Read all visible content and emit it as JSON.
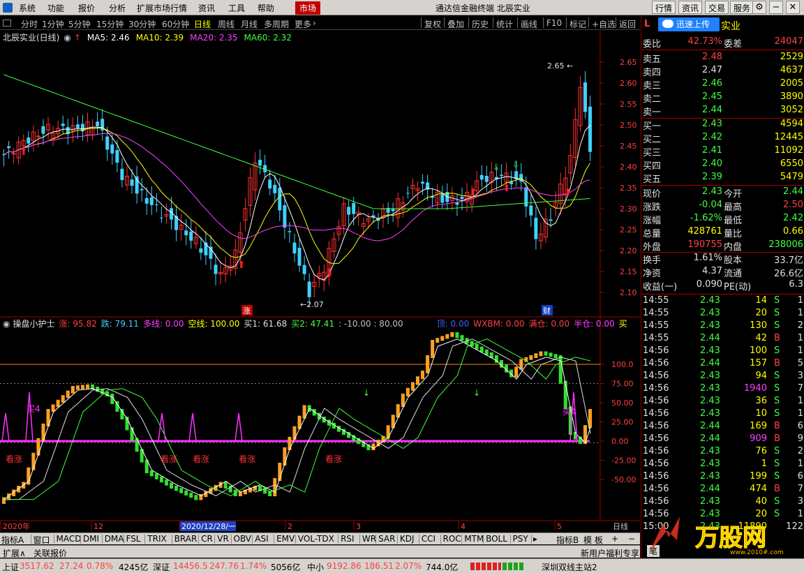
{
  "menubar": {
    "items": [
      "系统",
      "功能",
      "报价",
      "分析",
      "扩展市场行情",
      "资讯",
      "工具",
      "帮助"
    ],
    "active_tab": "市场",
    "window_title": "通达信金融终端 北辰实业",
    "right_buttons": [
      "行情",
      "资讯",
      "交易",
      "服务"
    ],
    "win_icons": [
      "settings-icon",
      "minimize-icon",
      "restore-icon",
      "close-icon"
    ]
  },
  "periodbar": {
    "periods": [
      "分时",
      "1分钟",
      "5分钟",
      "15分钟",
      "30分钟",
      "60分钟",
      "日线",
      "周线",
      "月线",
      "多周期",
      "更多"
    ],
    "selected": "日线",
    "tools": [
      "复权",
      "叠加",
      "历史",
      "统计",
      "画线",
      "F10",
      "标记",
      "+自选",
      "返回"
    ]
  },
  "main": {
    "title": "北辰实业(日线)",
    "ma": [
      {
        "label": "MA5: 2.46",
        "color": "#ffffff"
      },
      {
        "label": "MA10: 2.39",
        "color": "#ffff00"
      },
      {
        "label": "MA20: 2.35",
        "color": "#ff40ff"
      },
      {
        "label": "MA60: 2.32",
        "color": "#40ff40"
      }
    ],
    "high_label": "2.65",
    "low_label": "←2.07",
    "y_ticks": [
      "2.65",
      "2.60",
      "2.55",
      "2.50",
      "2.45",
      "2.40",
      "2.35",
      "2.30",
      "2.25",
      "2.20",
      "2.15",
      "2.10"
    ],
    "markers": [
      "涨",
      "财"
    ]
  },
  "indicator": {
    "name": "操盘小护士",
    "fields": [
      {
        "label": "涨: 95.82",
        "color": "#ff4040"
      },
      {
        "label": "跌: 79.11",
        "color": "#40d0ff"
      },
      {
        "label": "多线: 0.00",
        "color": "#ff40ff"
      },
      {
        "label": "空线: 100.00",
        "color": "#ffff00"
      },
      {
        "label": "买1: 61.68",
        "color": "#e0e0e0"
      },
      {
        "label": "买2: 47.41",
        "color": "#40ff40"
      },
      {
        "label": ": -10.00 : 80.00",
        "color": "#c0c0c0"
      },
      {
        "label": "顶: 0.00",
        "color": "#4060ff"
      },
      {
        "label": "WXBM: 0.00",
        "color": "#ff4040"
      },
      {
        "label": "满仓: 0.00",
        "color": "#ff4040"
      },
      {
        "label": "半仓: 0.00",
        "color": "#ff40ff"
      },
      {
        "label": "买",
        "color": "#ffff00"
      }
    ],
    "y_ticks": [
      "100.0",
      "75.00",
      "50.00",
      "25.00",
      "0.00",
      "-25.00",
      "-50.00"
    ],
    "labels": [
      "买4",
      "看涨",
      "看涨",
      "看涨",
      "看涨",
      "看涨",
      "买4"
    ]
  },
  "x_axis": {
    "labels": [
      "2020年",
      "12",
      "2020/12/28/一",
      "2",
      "3",
      "4",
      "5"
    ],
    "right_label": "日线"
  },
  "tabs": {
    "items": [
      "指标A",
      "窗口",
      "MACD",
      "DMI",
      "DMA",
      "FSL",
      "TRIX",
      "BRAR",
      "CR",
      "VR",
      "OBV",
      "ASI",
      "EMV",
      "VOL-TDX",
      "RSI",
      "WR",
      "SAR",
      "KDJ",
      "CCI",
      "ROC",
      "MTM",
      "BOLL",
      "PSY"
    ],
    "right": [
      "指标B",
      "模 板",
      "+",
      "−"
    ]
  },
  "status": {
    "left": [
      "扩展∧",
      "关联报价"
    ],
    "right": "新用户福利专享",
    "right2": "笔"
  },
  "bottom": {
    "sh_label": "上证",
    "sh_val": "3517.62",
    "sh_chg": "27.24",
    "sh_pct": "0.78%",
    "sh_amt": "4245亿",
    "sz_label": "深证",
    "sz_val": "14456.5",
    "sz_chg": "247.76",
    "sz_pct": "1.74%",
    "sz_amt": "5056亿",
    "zx_label": "中小",
    "zx_val": "9192.86",
    "zx_chg": "186.51",
    "zx_pct": "2.07%",
    "zx_amt": "744.0亿",
    "server": "深圳双线主站2"
  },
  "quote": {
    "badge": "L",
    "popup": "迅速上传",
    "name_suffix": "实业",
    "weibi_label": "委比",
    "weibi_val": "42.73%",
    "weicha_label": "委差",
    "weicha_val": "24047",
    "asks": [
      {
        "label": "卖五",
        "price": "2.48",
        "vol": "2529"
      },
      {
        "label": "卖四",
        "price": "2.47",
        "vol": "4637"
      },
      {
        "label": "卖三",
        "price": "2.46",
        "vol": "2005"
      },
      {
        "label": "卖二",
        "price": "2.45",
        "vol": "3890"
      },
      {
        "label": "卖一",
        "price": "2.44",
        "vol": "3052"
      }
    ],
    "bids": [
      {
        "label": "买一",
        "price": "2.43",
        "vol": "4594"
      },
      {
        "label": "买二",
        "price": "2.42",
        "vol": "12445"
      },
      {
        "label": "买三",
        "price": "2.41",
        "vol": "11092"
      },
      {
        "label": "买四",
        "price": "2.40",
        "vol": "6550"
      },
      {
        "label": "买五",
        "price": "2.39",
        "vol": "5479"
      }
    ],
    "stats": [
      {
        "l1": "现价",
        "v1": "2.43",
        "c1": "dn",
        "l2": "今开",
        "v2": "2.44",
        "c2": "dn"
      },
      {
        "l1": "涨跌",
        "v1": "-0.04",
        "c1": "dn",
        "l2": "最高",
        "v2": "2.50",
        "c2": "up"
      },
      {
        "l1": "涨幅",
        "v1": "-1.62%",
        "c1": "dn",
        "l2": "最低",
        "v2": "2.42",
        "c2": "dn"
      },
      {
        "l1": "总量",
        "v1": "428761",
        "c1": "yl",
        "l2": "量比",
        "v2": "0.66",
        "c2": "yl"
      },
      {
        "l1": "外盘",
        "v1": "190755",
        "c1": "up",
        "l2": "内盘",
        "v2": "238006",
        "c2": "dn"
      },
      {
        "l1": "换手",
        "v1": "1.61%",
        "c1": "wh",
        "l2": "股本",
        "v2": "33.7亿",
        "c2": "wh"
      },
      {
        "l1": "净资",
        "v1": "4.37",
        "c1": "wh",
        "l2": "流通",
        "v2": "26.6亿",
        "c2": "wh"
      },
      {
        "l1": "收益(一)",
        "v1": "0.090",
        "c1": "wh",
        "l2": "PE(动)",
        "v2": "6.3",
        "c2": "wh"
      }
    ],
    "ticks": [
      {
        "t": "14:55",
        "p": "2.43",
        "v": "14",
        "bs": "S",
        "n": "1",
        "pc": "dn",
        "vc": "yl"
      },
      {
        "t": "14:55",
        "p": "2.43",
        "v": "20",
        "bs": "S",
        "n": "1",
        "pc": "dn",
        "vc": "yl"
      },
      {
        "t": "14:55",
        "p": "2.43",
        "v": "130",
        "bs": "S",
        "n": "2",
        "pc": "dn",
        "vc": "yl"
      },
      {
        "t": "14:55",
        "p": "2.44",
        "v": "42",
        "bs": "B",
        "n": "1",
        "pc": "dn",
        "vc": "yl"
      },
      {
        "t": "14:56",
        "p": "2.43",
        "v": "100",
        "bs": "S",
        "n": "1",
        "pc": "dn",
        "vc": "yl"
      },
      {
        "t": "14:56",
        "p": "2.44",
        "v": "157",
        "bs": "B",
        "n": "5",
        "pc": "dn",
        "vc": "yl"
      },
      {
        "t": "14:56",
        "p": "2.43",
        "v": "94",
        "bs": "S",
        "n": "3",
        "pc": "dn",
        "vc": "yl"
      },
      {
        "t": "14:56",
        "p": "2.43",
        "v": "1940",
        "bs": "S",
        "n": "7",
        "pc": "dn",
        "vc": "mg"
      },
      {
        "t": "14:56",
        "p": "2.43",
        "v": "36",
        "bs": "S",
        "n": "1",
        "pc": "dn",
        "vc": "yl"
      },
      {
        "t": "14:56",
        "p": "2.43",
        "v": "10",
        "bs": "S",
        "n": "1",
        "pc": "dn",
        "vc": "yl"
      },
      {
        "t": "14:56",
        "p": "2.44",
        "v": "169",
        "bs": "B",
        "n": "6",
        "pc": "dn",
        "vc": "yl"
      },
      {
        "t": "14:56",
        "p": "2.44",
        "v": "909",
        "bs": "B",
        "n": "9",
        "pc": "dn",
        "vc": "mg"
      },
      {
        "t": "14:56",
        "p": "2.43",
        "v": "76",
        "bs": "S",
        "n": "2",
        "pc": "dn",
        "vc": "yl"
      },
      {
        "t": "14:56",
        "p": "2.43",
        "v": "1",
        "bs": "S",
        "n": "1",
        "pc": "dn",
        "vc": "yl"
      },
      {
        "t": "14:56",
        "p": "2.43",
        "v": "199",
        "bs": "S",
        "n": "6",
        "pc": "dn",
        "vc": "yl"
      },
      {
        "t": "14:56",
        "p": "2.44",
        "v": "474",
        "bs": "B",
        "n": "7",
        "pc": "dn",
        "vc": "yl"
      },
      {
        "t": "14:56",
        "p": "2.43",
        "v": "40",
        "bs": "S",
        "n": "3",
        "pc": "dn",
        "vc": "yl"
      },
      {
        "t": "14:56",
        "p": "2.43",
        "v": "20",
        "bs": "S",
        "n": "1",
        "pc": "dn",
        "vc": "yl"
      },
      {
        "t": "15:00",
        "p": "2.43",
        "v": "11890",
        "bs": "",
        "n": "122",
        "pc": "dn",
        "vc": "yl"
      }
    ],
    "watermark_text": "万股网",
    "watermark_url": "www.2010#.com"
  }
}
